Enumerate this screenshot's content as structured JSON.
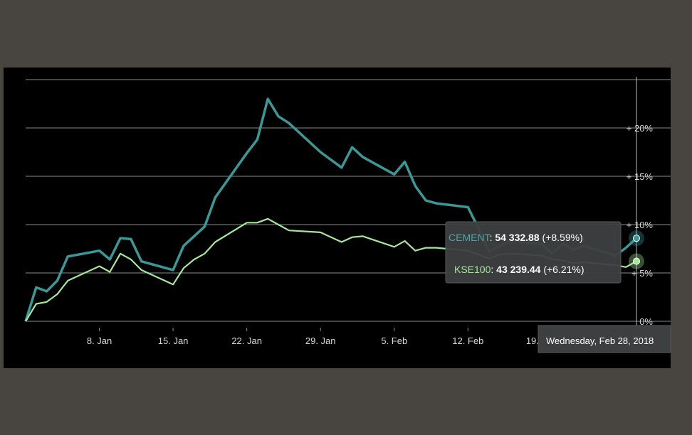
{
  "chart_data": {
    "type": "line",
    "x": [
      "2018-01-01",
      "2018-01-02",
      "2018-01-03",
      "2018-01-04",
      "2018-01-05",
      "2018-01-08",
      "2018-01-09",
      "2018-01-10",
      "2018-01-11",
      "2018-01-12",
      "2018-01-15",
      "2018-01-16",
      "2018-01-17",
      "2018-01-18",
      "2018-01-19",
      "2018-01-22",
      "2018-01-23",
      "2018-01-24",
      "2018-01-25",
      "2018-01-26",
      "2018-01-29",
      "2018-01-30",
      "2018-01-31",
      "2018-02-01",
      "2018-02-02",
      "2018-02-05",
      "2018-02-06",
      "2018-02-07",
      "2018-02-08",
      "2018-02-09",
      "2018-02-12",
      "2018-02-13",
      "2018-02-14",
      "2018-02-15",
      "2018-02-16",
      "2018-02-19",
      "2018-02-20",
      "2018-02-21",
      "2018-02-22",
      "2018-02-23",
      "2018-02-26",
      "2018-02-27",
      "2018-02-28"
    ],
    "xticks": [
      {
        "date": "2018-01-08",
        "label": "8. Jan"
      },
      {
        "date": "2018-01-15",
        "label": "15. Jan"
      },
      {
        "date": "2018-01-22",
        "label": "22. Jan"
      },
      {
        "date": "2018-01-29",
        "label": "29. Jan"
      },
      {
        "date": "2018-02-05",
        "label": "5. Feb"
      },
      {
        "date": "2018-02-12",
        "label": "12. Feb"
      },
      {
        "date": "2018-02-19",
        "label": "19. Feb"
      }
    ],
    "yticks": [
      {
        "value": 0,
        "label": "0%"
      },
      {
        "value": 5,
        "label": "+ 5%"
      },
      {
        "value": 10,
        "label": "+ 10%"
      },
      {
        "value": 15,
        "label": "+ 15%"
      },
      {
        "value": 20,
        "label": "+ 20%"
      }
    ],
    "ylim": [
      0,
      25
    ],
    "grid": true,
    "series": [
      {
        "name": "CEMENT",
        "color": "#3a9896",
        "values": [
          0,
          3.5,
          3.1,
          4.2,
          6.7,
          7.3,
          6.4,
          8.6,
          8.5,
          6.2,
          5.3,
          7.8,
          8.8,
          9.8,
          12.8,
          17.4,
          18.8,
          23.0,
          21.2,
          20.5,
          17.5,
          16.7,
          15.9,
          18.0,
          17.0,
          15.2,
          16.5,
          14.0,
          12.5,
          12.2,
          11.8,
          9.6,
          7.2,
          7.8,
          8.3,
          8.0,
          7.0,
          8.0,
          7.4,
          7.8,
          6.8,
          7.6,
          8.59
        ]
      },
      {
        "name": "KSE100",
        "color": "#a5e89a",
        "values": [
          0,
          1.8,
          2.0,
          2.8,
          4.2,
          5.7,
          5.1,
          7.0,
          6.4,
          5.3,
          3.8,
          5.5,
          6.4,
          7.0,
          8.2,
          10.2,
          10.2,
          10.6,
          10.0,
          9.4,
          9.2,
          8.7,
          8.2,
          8.7,
          8.8,
          7.7,
          8.3,
          7.3,
          7.6,
          7.6,
          7.3,
          6.9,
          6.5,
          6.9,
          7.0,
          6.8,
          6.4,
          6.3,
          6.0,
          6.1,
          5.8,
          5.6,
          6.21
        ]
      }
    ],
    "tooltip": {
      "date": "Wednesday, Feb 28, 2018",
      "rows": [
        {
          "series": "CEMENT",
          "value": "54 332.88",
          "change": "(+8.59%)",
          "color": "#3a9896"
        },
        {
          "series": "KSE100",
          "value": "43 239.44",
          "change": "(+6.21%)",
          "color": "#a5e89a"
        }
      ]
    }
  }
}
